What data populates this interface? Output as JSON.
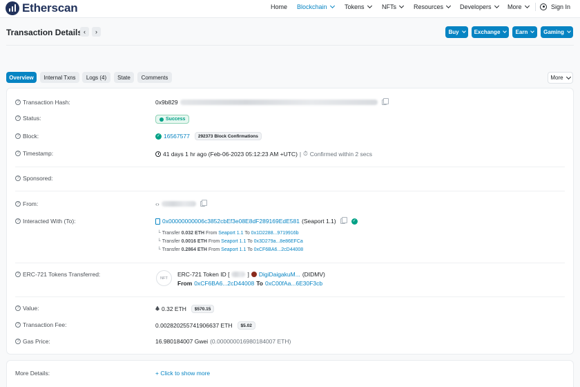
{
  "brand": {
    "name": "Etherscan"
  },
  "nav": {
    "home": "Home",
    "blockchain": "Blockchain",
    "tokens": "Tokens",
    "nfts": "NFTs",
    "resources": "Resources",
    "developers": "Developers",
    "more": "More",
    "sign_in": "Sign In"
  },
  "header": {
    "title": "Transaction Details",
    "prev": "‹",
    "next": "›",
    "buttons": [
      "Buy",
      "Exchange",
      "Earn",
      "Gaming"
    ]
  },
  "tabs": [
    {
      "label": "Overview",
      "active": true
    },
    {
      "label": "Internal Txns",
      "active": false
    },
    {
      "label": "Logs (4)",
      "active": false
    },
    {
      "label": "State",
      "active": false
    },
    {
      "label": "Comments",
      "active": false
    }
  ],
  "more_menu": "More",
  "details": {
    "tx_hash": {
      "label": "Transaction Hash:",
      "value": "0x9b829"
    },
    "status": {
      "label": "Status:",
      "value": "Success"
    },
    "block": {
      "label": "Block:",
      "value": "16567577",
      "confirmations": "292373 Block Confirmations"
    },
    "timestamp": {
      "label": "Timestamp:",
      "value": "41 days 1 hr ago (Feb-06-2023 05:12:23 AM +UTC)",
      "separator": "|",
      "confirmed": "Confirmed within 2 secs"
    },
    "sponsored": {
      "label": "Sponsored:"
    },
    "from": {
      "label": "From:"
    },
    "interacted": {
      "label": "Interacted With (To):",
      "address": "0x00000000006c3852cbEf3e08E8dF289169EdE581",
      "name": "(Seaport 1.1)"
    },
    "transfers": [
      {
        "prefix": "Transfer",
        "amount": "0.032 ETH",
        "from_label": "From",
        "from": "Seaport 1.1",
        "to_label": "To",
        "to": "0x1D2288...9719916b"
      },
      {
        "prefix": "Transfer",
        "amount": "0.0016 ETH",
        "from_label": "From",
        "from": "Seaport 1.1",
        "to_label": "To",
        "to": "0x3D279a...8e86EFCa"
      },
      {
        "prefix": "Transfer",
        "amount": "0.2864 ETH",
        "from_label": "From",
        "from": "Seaport 1.1",
        "to_label": "To",
        "to": "0xCF6BA6...2cD44008"
      }
    ],
    "erc721": {
      "label": "ERC-721 Tokens Transferred:",
      "nft_placeholder": "NFT",
      "token_prefix": "ERC-721 Token ID [",
      "token_bracket_close": "]",
      "token_name": "DigiDaigakuM...",
      "token_symbol": "(DIDMV)",
      "from_label": "From",
      "from": "0xCF6BA6...2cD44008",
      "to_label": "To",
      "to": "0xC00fAa...6E30F3cb"
    },
    "value": {
      "label": "Value:",
      "amount": "0.32 ETH",
      "usd": "$570.15"
    },
    "fee": {
      "label": "Transaction Fee:",
      "amount": "0.002820255741906637 ETH",
      "usd": "$5.02"
    },
    "gas": {
      "label": "Gas Price:",
      "gwei": "16.980184007 Gwei",
      "eth": "(0.000000016980184007 ETH)"
    }
  },
  "more_details": {
    "label": "More Details:",
    "action": "+ Click to show more"
  },
  "colors": {
    "primary": "#0784c3",
    "brand": "#21325b",
    "success": "#00a186"
  }
}
